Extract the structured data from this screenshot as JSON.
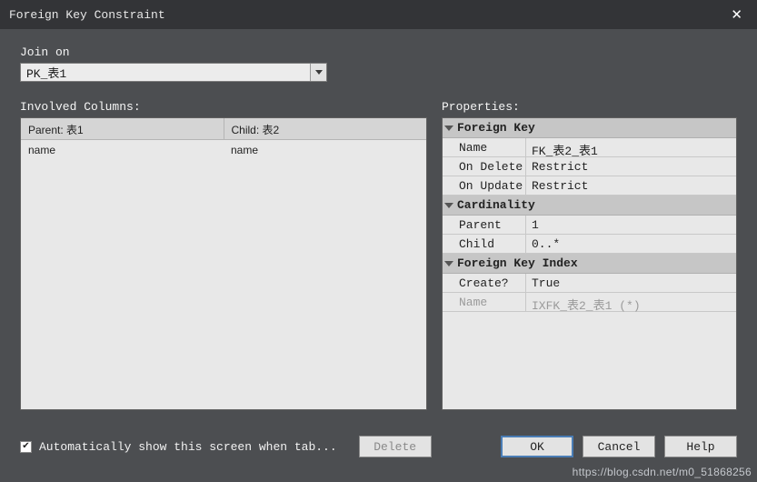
{
  "titlebar": {
    "title": "Foreign Key Constraint"
  },
  "join_on": {
    "label": "Join on",
    "value": "PK_表1"
  },
  "involved_columns": {
    "label": "Involved Columns:",
    "headers": {
      "parent": "Parent: 表1",
      "child": "Child: 表2"
    },
    "rows": [
      {
        "parent": "name",
        "child": "name"
      }
    ]
  },
  "properties": {
    "label": "Properties:",
    "groups": [
      {
        "title": "Foreign Key",
        "rows": [
          {
            "name": "Name",
            "value": "FK_表2_表1"
          },
          {
            "name": "On Delete",
            "value": "Restrict"
          },
          {
            "name": "On Update",
            "value": "Restrict"
          }
        ]
      },
      {
        "title": "Cardinality",
        "rows": [
          {
            "name": "Parent",
            "value": "1"
          },
          {
            "name": "Child",
            "value": "0..*"
          }
        ]
      },
      {
        "title": "Foreign Key Index",
        "rows": [
          {
            "name": "Create?",
            "value": "True"
          },
          {
            "name": "Name",
            "value": "IXFK_表2_表1 (*)",
            "disabled": true
          }
        ]
      }
    ]
  },
  "footer": {
    "auto_show_label": "Automatically show this screen when tab...",
    "auto_show_checked": true,
    "delete_label": "Delete",
    "ok_label": "OK",
    "cancel_label": "Cancel",
    "help_label": "Help"
  },
  "watermark": "https://blog.csdn.net/m0_51868256"
}
